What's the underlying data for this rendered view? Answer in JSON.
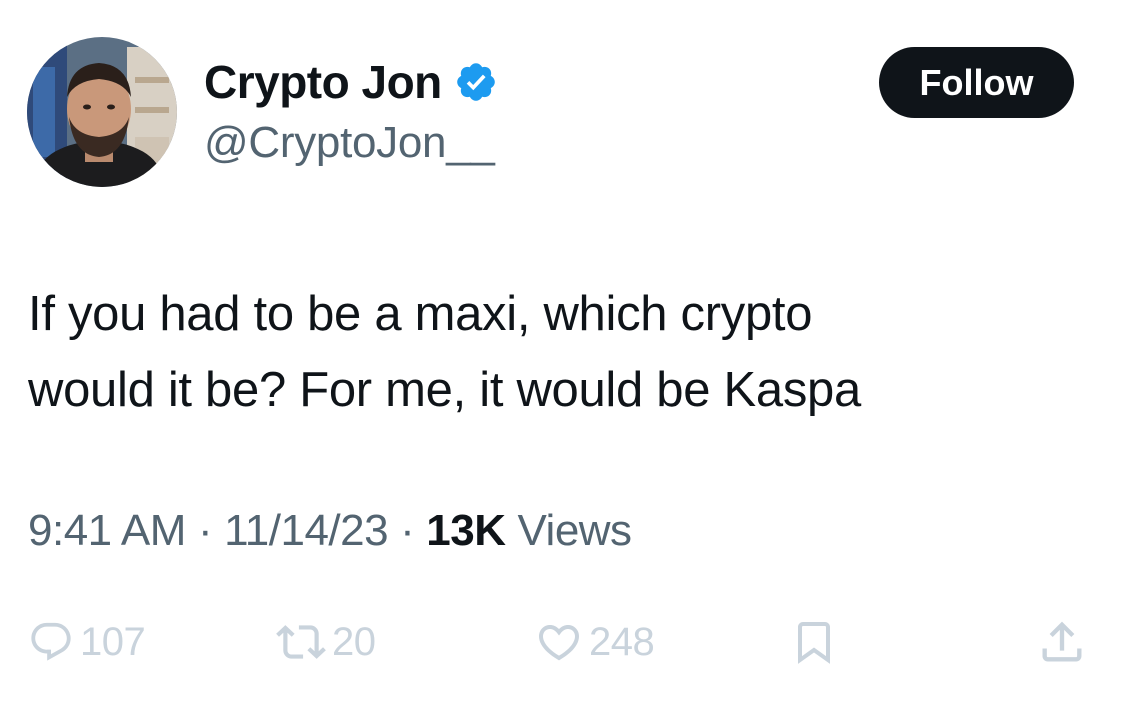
{
  "author": {
    "display_name": "Crypto Jon",
    "handle": "@CryptoJon__",
    "verified_icon": "verified-badge-icon",
    "verified_color": "#1d9bf0"
  },
  "follow_button": {
    "label": "Follow"
  },
  "tweet": {
    "line1": "If you had to be a maxi, which crypto",
    "line2": "would it be? For me, it would be Kaspa"
  },
  "meta": {
    "time": "9:41 AM",
    "separator": "·",
    "date": "11/14/23",
    "views_count": "13K",
    "views_label": "Views"
  },
  "actions": {
    "reply_count": "107",
    "retweet_count": "20",
    "like_count": "248",
    "reply_icon": "reply-icon",
    "retweet_icon": "retweet-icon",
    "like_icon": "heart-icon",
    "bookmark_icon": "bookmark-icon",
    "share_icon": "share-icon"
  },
  "colors": {
    "text": "#0f1419",
    "secondary": "#536471",
    "action_icons": "#c9d3dc",
    "button_bg": "#0f1419"
  }
}
